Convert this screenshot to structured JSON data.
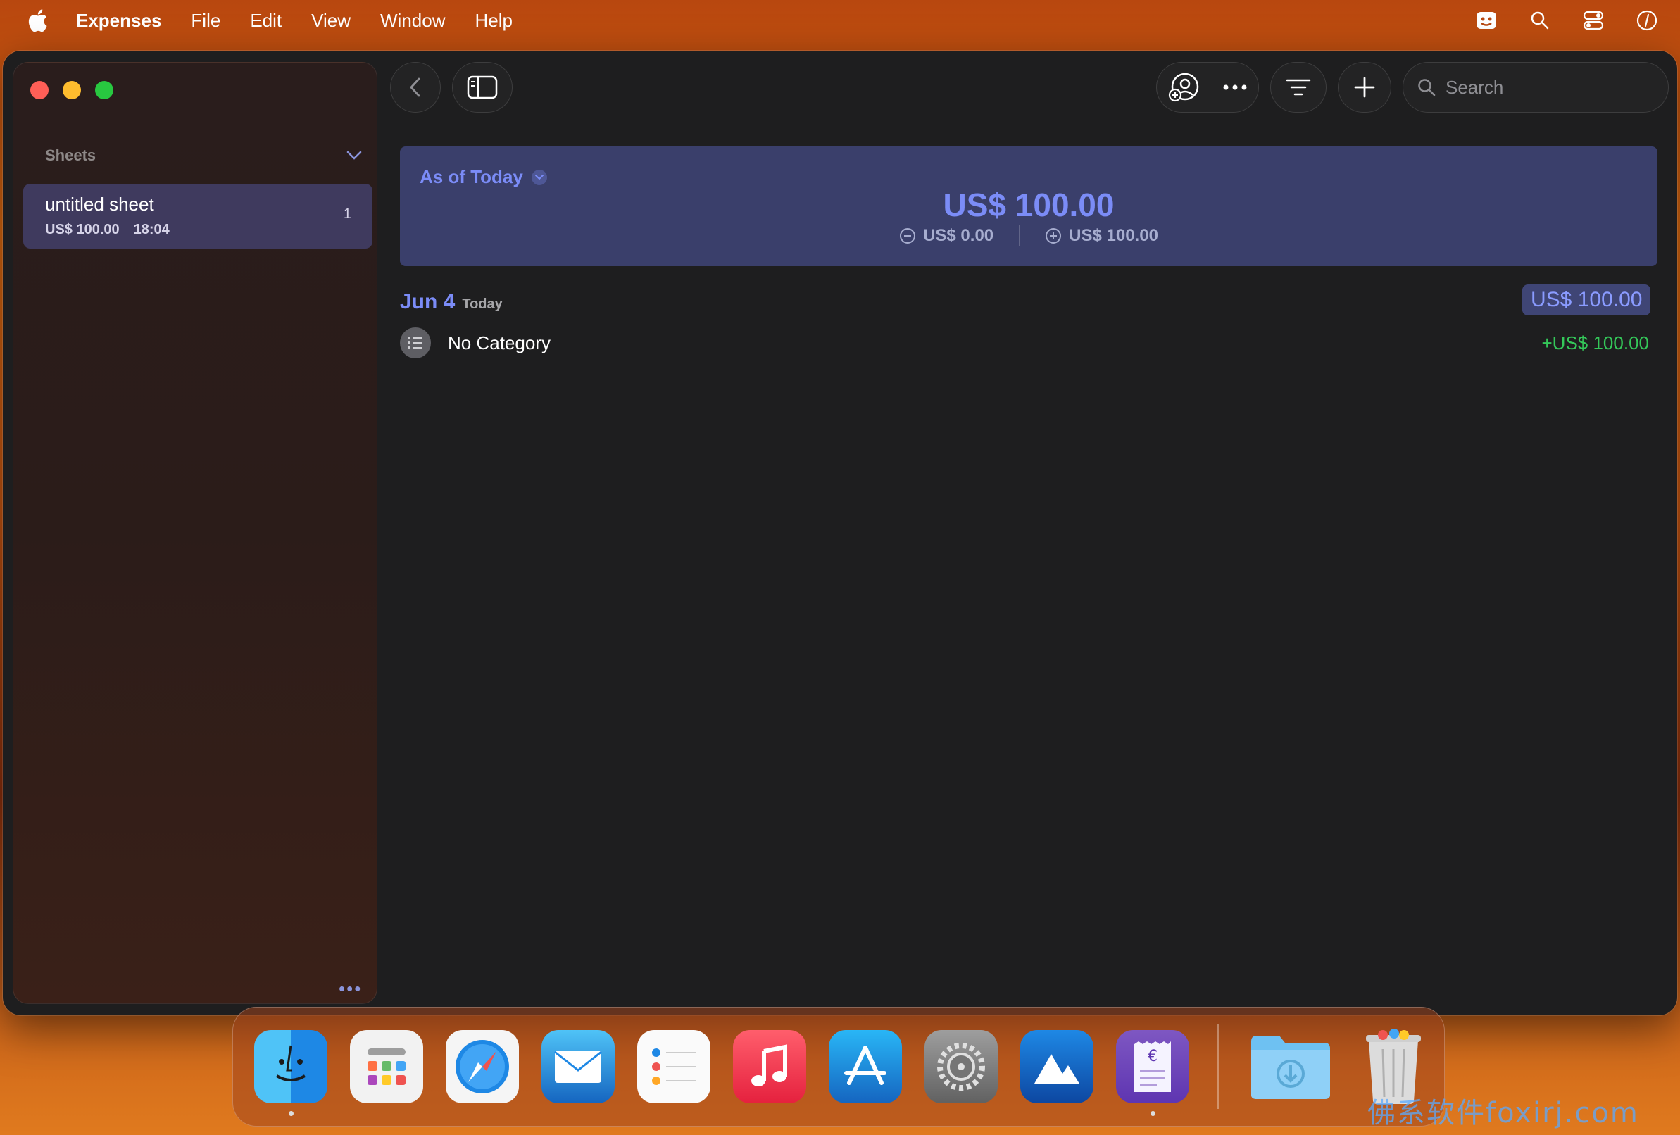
{
  "menubar": {
    "app_name": "Expenses",
    "items": [
      "File",
      "Edit",
      "View",
      "Window",
      "Help"
    ]
  },
  "sidebar": {
    "section_title": "Sheets",
    "sheets": [
      {
        "name": "untitled sheet",
        "amount": "US$ 100.00",
        "time": "18:04",
        "count": "1"
      }
    ],
    "more_label": "•••"
  },
  "toolbar": {
    "search_placeholder": "Search"
  },
  "summary": {
    "period_label": "As of Today",
    "total": "US$ 100.00",
    "expenses": "US$ 0.00",
    "income": "US$ 100.00",
    "accent_color": "#7b8cf7"
  },
  "days": [
    {
      "date": "Jun 4",
      "relative": "Today",
      "total": "US$ 100.00",
      "entries": [
        {
          "category": "No Category",
          "amount": "+US$ 100.00",
          "amount_color": "#34c759"
        }
      ]
    }
  ],
  "dock": {
    "apps": [
      "finder",
      "launchpad",
      "safari",
      "mail",
      "reminders",
      "music",
      "app-store",
      "system-settings",
      "altitude",
      "expenses",
      "downloads",
      "trash"
    ]
  },
  "watermark": "佛系软件foxirj.com"
}
